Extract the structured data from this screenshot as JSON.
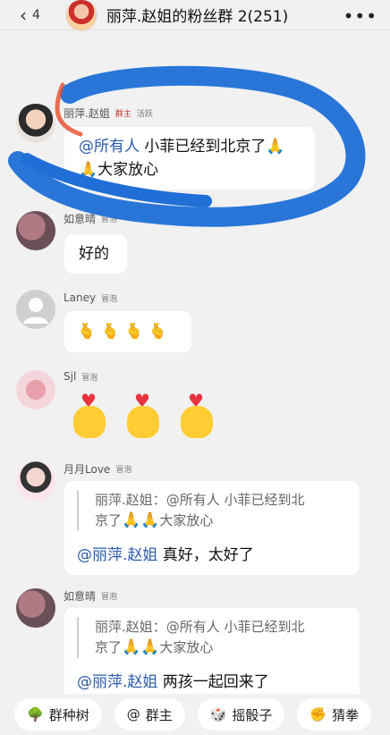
{
  "header": {
    "back_count": "4",
    "title": "丽萍.赵姐的粉丝群 2(251)",
    "more": "•••"
  },
  "messages": [
    {
      "sender": "丽萍.赵姐",
      "tag": "群主",
      "tag2": "活跃",
      "mention": "@所有人",
      "text": " 小菲已经到北京了",
      "text2": "大家放心",
      "emoji": "🙏"
    },
    {
      "sender": "如意晴",
      "tag": "冒泡",
      "text": "好的"
    },
    {
      "sender": "Laney",
      "tag": "冒泡",
      "emojis": [
        "🫰",
        "🫰",
        "🫰",
        "🫰"
      ]
    },
    {
      "sender": "Sjl",
      "tag": "冒泡"
    },
    {
      "sender": "月月Love",
      "tag": "冒泡",
      "quote_line1": "丽萍.赵姐：@所有人 小菲已经到北",
      "quote_line2": "京了",
      "quote_line2_tail": "大家放心",
      "reply_mention": "@丽萍.赵姐",
      "reply_text": " 真好，太好了"
    },
    {
      "sender": "如意晴",
      "tag": "冒泡",
      "quote_line1": "丽萍.赵姐：@所有人 小菲已经到北",
      "quote_line2": "京了",
      "quote_line2_tail": "大家放心",
      "reply_mention": "@丽萍.赵姐",
      "reply_text": " 两孩一起回来了"
    }
  ],
  "bottom_bar": [
    {
      "label": "群种树",
      "icon": "tree-icon"
    },
    {
      "label": "群主",
      "icon": "at-icon"
    },
    {
      "label": "摇骰子",
      "icon": "dice-icon"
    },
    {
      "label": "猜拳",
      "icon": "fist-icon"
    }
  ],
  "colors": {
    "mention": "#2b5cab",
    "scribble": "#1f6fd6",
    "background": "#f1f1f1"
  }
}
